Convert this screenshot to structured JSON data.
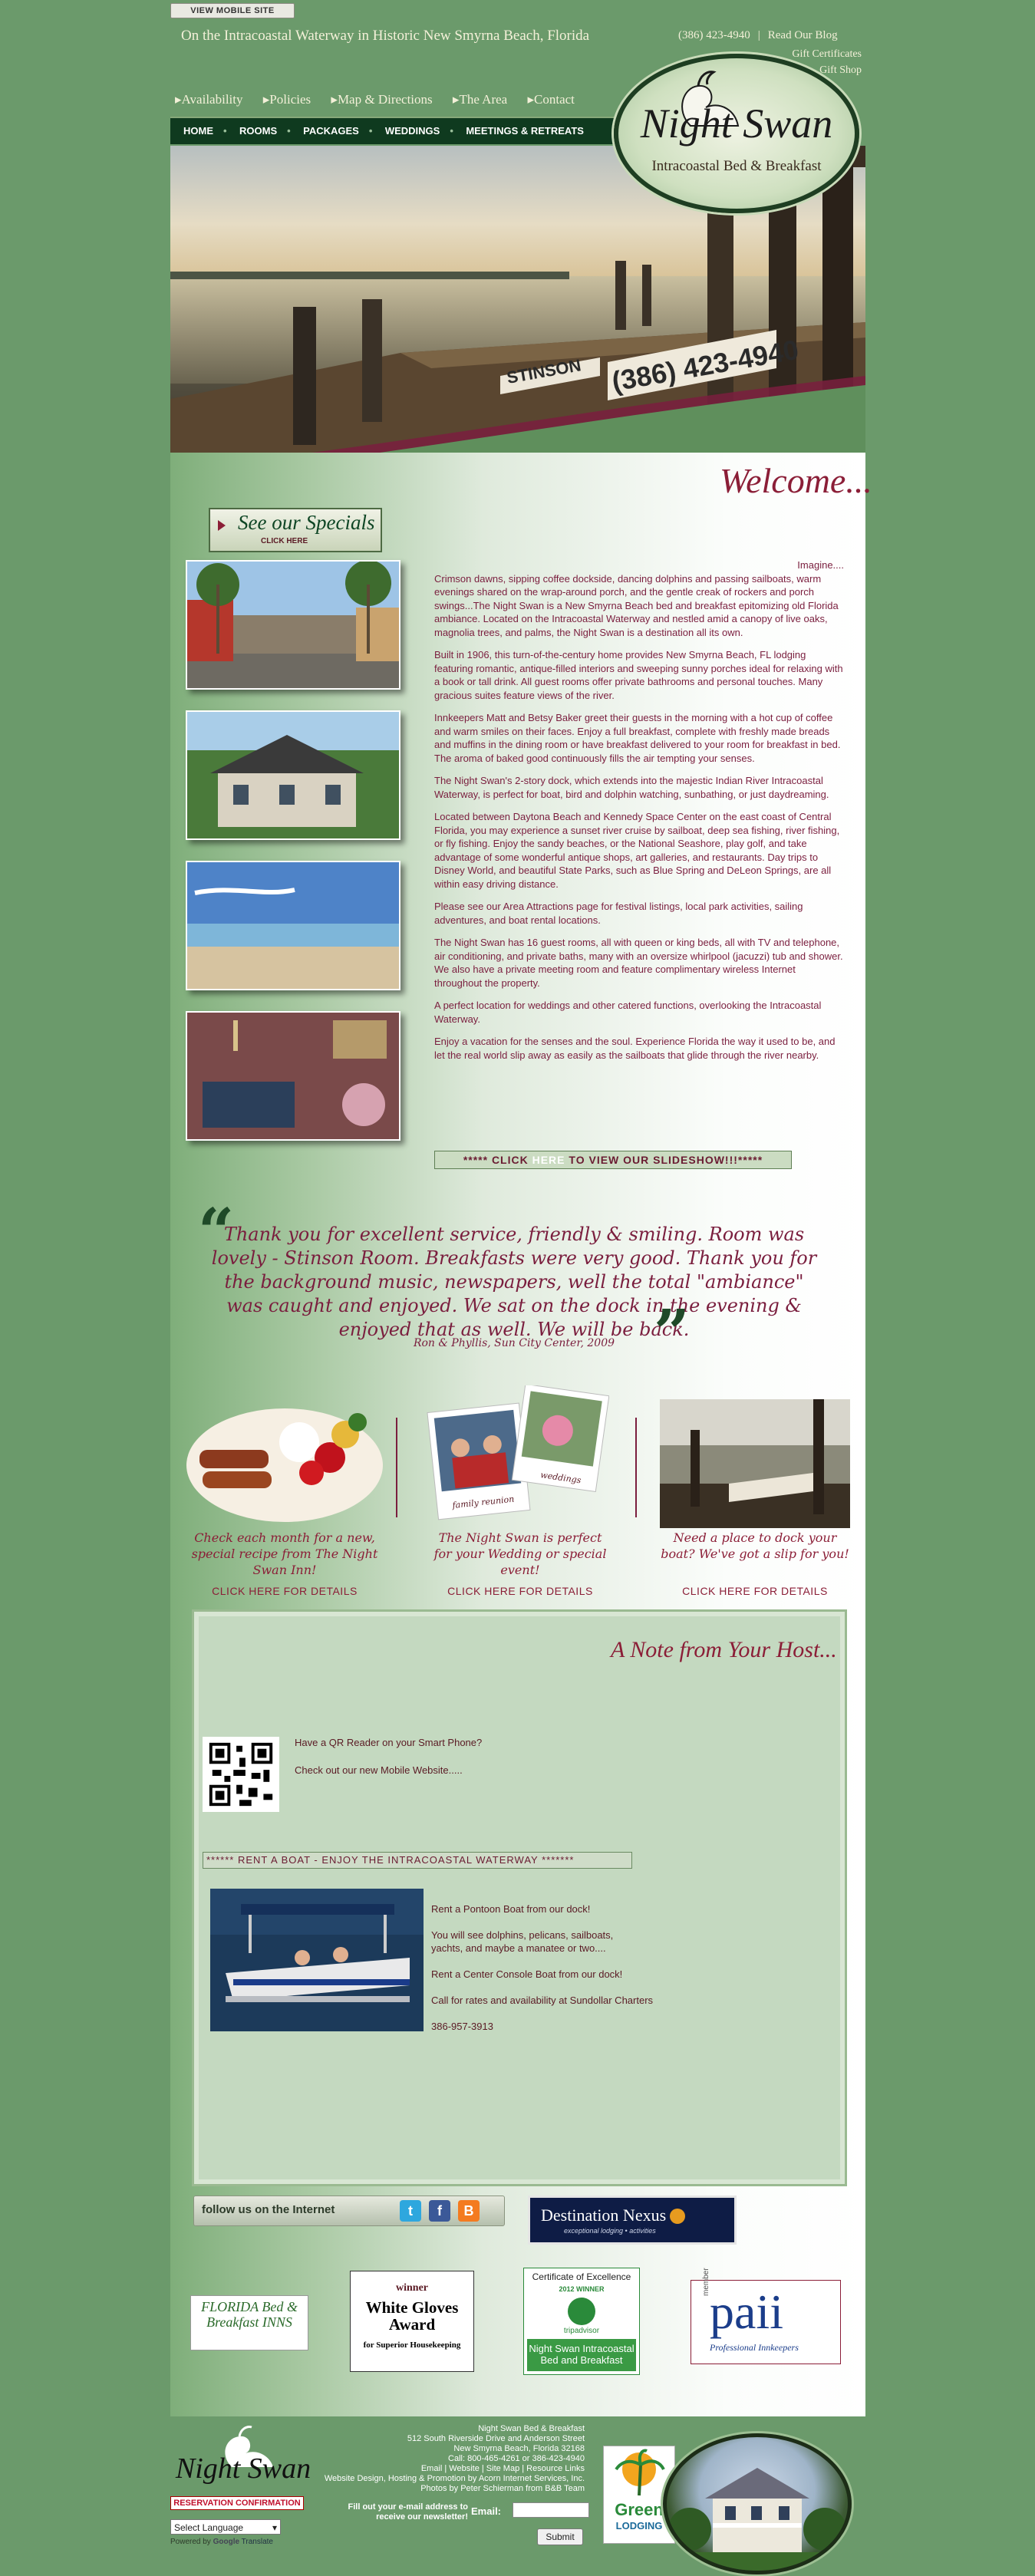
{
  "top": {
    "mobile_site": "VIEW MOBILE SITE",
    "tagline": "On the Intracoastal Waterway in Historic New Smyrna Beach, Florida",
    "phone": "(386) 423-4940",
    "blog": "Read Our Blog",
    "gift": "Gift Certificates",
    "shop": "Gift Shop"
  },
  "subnav": [
    "Availability",
    "Policies",
    "Map & Directions",
    "The Area",
    "Contact"
  ],
  "mainnav": [
    "HOME",
    "ROOMS",
    "PACKAGES",
    "WEDDINGS",
    "MEETINGS & RETREATS"
  ],
  "logo": {
    "name": "Night Swan",
    "sub": "Intracoastal Bed & Breakfast"
  },
  "hero": {
    "sign_text": "(386) 423-4940"
  },
  "welcome": "Welcome...",
  "specials": {
    "title": "See our Specials",
    "click": "CLICK HERE"
  },
  "body": {
    "imagine": "Imagine....",
    "paragraphs": [
      "Crimson dawns, sipping coffee dockside, dancing dolphins and passing sailboats, warm evenings shared on the wrap-around porch, and the gentle creak of rockers and porch swings...The Night Swan is a New Smyrna Beach bed and breakfast epitomizing old Florida ambiance. Located on the Intracoastal Waterway and nestled amid a canopy of live oaks, magnolia trees, and palms, the Night Swan is a destination all its own.",
      "Built in 1906, this turn-of-the-century home provides New Smyrna Beach, FL lodging featuring romantic, antique-filled interiors and sweeping sunny porches ideal for relaxing with a book or tall drink. All guest rooms offer private bathrooms and personal touches. Many gracious suites feature views of the river.",
      "Innkeepers Matt and Betsy Baker greet their guests in the morning with a hot cup of coffee and warm smiles on their faces. Enjoy a full breakfast, complete with freshly made breads and muffins in the dining room or have breakfast delivered to your room for breakfast in bed. The aroma of baked good continuously fills the air tempting your senses.",
      "The Night Swan's 2-story dock, which extends into the majestic Indian River Intracoastal Waterway, is perfect for boat, bird and dolphin watching, sunbathing, or just daydreaming.",
      "Located between Daytona Beach and Kennedy Space Center on the east coast of Central Florida, you may experience a sunset river cruise by sailboat, deep sea fishing, river fishing, or fly fishing. Enjoy the sandy beaches, or the National Seashore, play golf, and take advantage of some wonderful antique shops, art galleries, and restaurants. Day trips to Disney World, and beautiful State Parks, such as Blue Spring and DeLeon Springs, are all within easy driving distance.",
      "Please see our Area Attractions page for festival listings, local park activities, sailing adventures, and boat rental locations.",
      "The Night Swan has 16 guest rooms, all with queen or king beds, all with TV and telephone, air conditioning, and private baths, many with an oversize whirlpool (jacuzzi) tub and shower. We also have a private meeting room and feature complimentary wireless Internet throughout the property.",
      "A perfect location for weddings and other catered functions, overlooking the Intracoastal Waterway.",
      "Enjoy a vacation for the senses and the soul. Experience Florida the way it used to be, and let the real world slip away as easily as the sailboats that glide through the river nearby."
    ],
    "slideshow_pre": "***** CLICK ",
    "slideshow_here": "HERE",
    "slideshow_post": " TO VIEW OUR SLIDESHOW!!!*****"
  },
  "testimonial": {
    "text": "Thank you for excellent service, friendly & smiling. Room was lovely - Stinson Room. Breakfasts were very good. Thank you for the background music, newspapers, well the total \"ambiance\" was caught and enjoyed. We sat on the dock in the evening & enjoyed that as well. We will be back.",
    "author": "Ron & Phyllis, Sun City Center, 2009"
  },
  "promos": [
    {
      "caption": "Check each month for a new, special recipe from The Night Swan Inn!",
      "link": "CLICK HERE FOR DETAILS"
    },
    {
      "caption": "The Night Swan is perfect for your Wedding or special event!",
      "link": "CLICK HERE FOR DETAILS",
      "photo_labels": [
        "family reunion",
        "weddings"
      ]
    },
    {
      "caption": "Need a place to dock your boat? We've got a slip for you!",
      "link": "CLICK HERE FOR DETAILS"
    }
  ],
  "host": {
    "title": "A Note from Your Host...",
    "qr_q": "Have a QR Reader on your Smart Phone?",
    "qr_mobile": "Check out our new Mobile Website.....",
    "rent_bar": "******     RENT A BOAT - ENJOY THE INTRACOASTAL WATERWAY     *******",
    "boat_lines": [
      "Rent a Pontoon Boat from our dock!",
      "You will see dolphins, pelicans, sailboats, yachts, and maybe a manatee or two....",
      " Rent a Center Console Boat from our dock!",
      "Call for rates and availability at Sundollar Charters",
      " 386-957-3913"
    ]
  },
  "follow": {
    "label": "follow us on the Internet"
  },
  "destination_nexus": {
    "name": "Destination Nexus",
    "tag": "exceptional lodging • activities"
  },
  "badges": {
    "florida_bb": "FLORIDA Bed & Breakfast INNS",
    "white_gloves": [
      "winner",
      "White Gloves Award",
      "for Superior Housekeeping"
    ],
    "tripadvisor": [
      "Certificate of Excellence",
      "2012 WINNER",
      "tripadvisor",
      "Night Swan Intracoastal Bed and Breakfast"
    ],
    "paii": [
      "member",
      "paii",
      "Professional Innkeepers"
    ]
  },
  "footer": {
    "logo_name": "Night Swan",
    "reservation": "RESERVATION CONFIRMATION",
    "select_language": "Select Language",
    "powered": "Powered by",
    "google": "Google",
    "translate": "Translate",
    "address_lines": [
      "Night Swan Bed & Breakfast",
      "512 South Riverside Drive and Anderson Street",
      "New Smyrna Beach, Florida 32168",
      "Call: 800-465-4261 or 386-423-4940",
      "Email | Website | Site Map | Resource Links",
      "Website Design, Hosting & Promotion by Acorn Internet Services, Inc.",
      "Photos by Peter Schierman from B&B Team"
    ],
    "newsletter": "Fill out your e-mail address to receive our newsletter!",
    "email_label": "Email:",
    "submit": "Submit",
    "green_lodging": [
      "Green",
      "LODGING"
    ]
  },
  "colors": {
    "background": "#6b9a6b",
    "nav": "#0f3a1f",
    "accent": "#8b1e37"
  }
}
